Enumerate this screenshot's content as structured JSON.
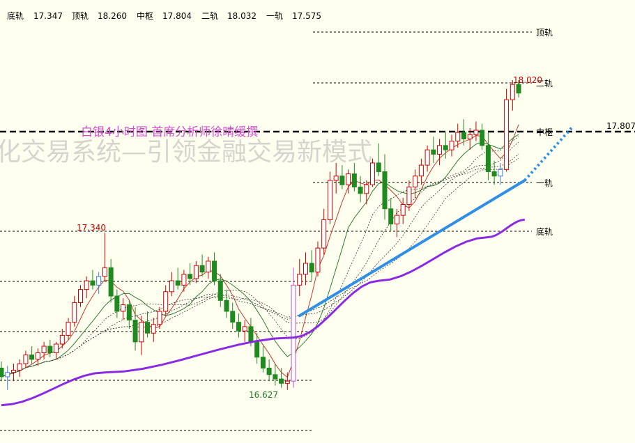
{
  "header": {
    "items": [
      {
        "label": "底轨",
        "value": "17.347"
      },
      {
        "label": "顶轨",
        "value": "18.260"
      },
      {
        "label": "中枢",
        "value": "17.804"
      },
      {
        "label": "二轨",
        "value": "18.032"
      },
      {
        "label": "一轨",
        "value": "17.575"
      }
    ]
  },
  "subtitle": "白银4小时图  首席分析师徐晴缓撰",
  "watermark": "化交易系统—引领金融交易新模式",
  "colors": {
    "background": "#fffff0",
    "up": "#cc0000",
    "down": "#1f8a1f",
    "special": "#3a7fdc",
    "trendline": "#2f8ee6",
    "slow_ma": "#8a2be2",
    "subtitle": "#d24fd0"
  },
  "chart_data": {
    "type": "candlestick",
    "y_range": [
      16.45,
      18.48
    ],
    "levels": [
      {
        "name": "顶轨",
        "value": 18.26
      },
      {
        "name": "二轨",
        "value": 18.032
      },
      {
        "name": "中枢",
        "value": 17.807
      },
      {
        "name": "一轨",
        "value": 17.575
      },
      {
        "name": "底轨",
        "value": 17.347
      }
    ],
    "annotations": [
      {
        "text": "18.020",
        "value": 18.02
      },
      {
        "text": "17.807",
        "value": 17.807
      },
      {
        "text": "17.340",
        "value": 17.34
      },
      {
        "text": "16.627",
        "value": 16.627
      }
    ],
    "candles": [
      [
        16.72,
        16.75,
        16.66,
        16.68
      ],
      [
        16.68,
        16.73,
        16.62,
        16.7
      ],
      [
        16.7,
        16.74,
        16.66,
        16.71
      ],
      [
        16.71,
        16.76,
        16.68,
        16.74
      ],
      [
        16.74,
        16.8,
        16.72,
        16.78
      ],
      [
        16.78,
        16.82,
        16.74,
        16.76
      ],
      [
        16.76,
        16.81,
        16.73,
        16.79
      ],
      [
        16.79,
        16.84,
        16.76,
        16.82
      ],
      [
        16.82,
        16.85,
        16.77,
        16.79
      ],
      [
        16.79,
        16.84,
        16.76,
        16.83
      ],
      [
        16.83,
        16.9,
        16.81,
        16.87
      ],
      [
        16.87,
        16.95,
        16.85,
        16.93
      ],
      [
        16.93,
        17.05,
        16.91,
        17.02
      ],
      [
        17.02,
        17.1,
        17.0,
        17.08
      ],
      [
        17.08,
        17.14,
        17.04,
        17.12
      ],
      [
        17.12,
        17.17,
        17.08,
        17.1
      ],
      [
        17.1,
        17.16,
        17.06,
        17.14
      ],
      [
        17.14,
        17.34,
        17.12,
        17.18
      ],
      [
        17.18,
        17.22,
        17.02,
        17.05
      ],
      [
        17.05,
        17.08,
        16.95,
        16.98
      ],
      [
        16.98,
        17.04,
        16.94,
        17.01
      ],
      [
        17.01,
        17.03,
        16.9,
        16.94
      ],
      [
        16.94,
        17.0,
        16.8,
        16.84
      ],
      [
        16.84,
        16.96,
        16.78,
        16.93
      ],
      [
        16.93,
        16.98,
        16.86,
        16.88
      ],
      [
        16.88,
        16.95,
        16.84,
        16.92
      ],
      [
        16.92,
        17.0,
        16.9,
        16.98
      ],
      [
        16.98,
        17.1,
        16.96,
        17.07
      ],
      [
        17.07,
        17.16,
        17.05,
        17.12
      ],
      [
        17.12,
        17.18,
        17.08,
        17.1
      ],
      [
        17.1,
        17.17,
        17.07,
        17.15
      ],
      [
        17.15,
        17.2,
        17.1,
        17.13
      ],
      [
        17.13,
        17.21,
        17.11,
        17.19
      ],
      [
        17.19,
        17.24,
        17.14,
        17.16
      ],
      [
        17.16,
        17.23,
        17.13,
        17.21
      ],
      [
        17.21,
        17.25,
        17.1,
        17.12
      ],
      [
        17.12,
        17.15,
        17.0,
        17.03
      ],
      [
        17.03,
        17.08,
        16.95,
        16.98
      ],
      [
        16.98,
        17.02,
        16.9,
        16.93
      ],
      [
        16.93,
        16.97,
        16.86,
        16.89
      ],
      [
        16.89,
        16.94,
        16.84,
        16.91
      ],
      [
        16.91,
        16.95,
        16.82,
        16.84
      ],
      [
        16.84,
        16.88,
        16.74,
        16.77
      ],
      [
        16.77,
        16.82,
        16.7,
        16.72
      ],
      [
        16.72,
        16.76,
        16.66,
        16.69
      ],
      [
        16.69,
        16.74,
        16.64,
        16.67
      ],
      [
        16.67,
        16.72,
        16.63,
        16.65
      ],
      [
        16.65,
        16.7,
        16.62,
        16.66
      ],
      [
        16.66,
        17.18,
        16.63,
        17.1
      ],
      [
        17.1,
        17.22,
        17.05,
        17.15
      ],
      [
        17.15,
        17.25,
        17.1,
        17.2
      ],
      [
        17.2,
        17.26,
        17.12,
        17.16
      ],
      [
        17.16,
        17.3,
        17.14,
        17.27
      ],
      [
        17.27,
        17.45,
        17.24,
        17.4
      ],
      [
        17.4,
        17.62,
        17.38,
        17.58
      ],
      [
        17.58,
        17.66,
        17.52,
        17.6
      ],
      [
        17.6,
        17.65,
        17.54,
        17.56
      ],
      [
        17.56,
        17.63,
        17.52,
        17.61
      ],
      [
        17.61,
        17.66,
        17.53,
        17.55
      ],
      [
        17.55,
        17.6,
        17.48,
        17.52
      ],
      [
        17.52,
        17.58,
        17.47,
        17.56
      ],
      [
        17.56,
        17.68,
        17.55,
        17.66
      ],
      [
        17.66,
        17.75,
        17.6,
        17.62
      ],
      [
        17.62,
        17.7,
        17.4,
        17.45
      ],
      [
        17.45,
        17.5,
        17.35,
        17.38
      ],
      [
        17.38,
        17.45,
        17.32,
        17.42
      ],
      [
        17.42,
        17.5,
        17.38,
        17.47
      ],
      [
        17.47,
        17.58,
        17.44,
        17.55
      ],
      [
        17.55,
        17.63,
        17.5,
        17.6
      ],
      [
        17.6,
        17.68,
        17.56,
        17.65
      ],
      [
        17.65,
        17.74,
        17.62,
        17.72
      ],
      [
        17.72,
        17.78,
        17.66,
        17.7
      ],
      [
        17.7,
        17.77,
        17.65,
        17.74
      ],
      [
        17.74,
        17.8,
        17.68,
        17.72
      ],
      [
        17.72,
        17.79,
        17.69,
        17.76
      ],
      [
        17.76,
        17.84,
        17.73,
        17.8
      ],
      [
        17.8,
        17.86,
        17.74,
        17.77
      ],
      [
        17.77,
        17.82,
        17.72,
        17.79
      ],
      [
        17.79,
        17.85,
        17.76,
        17.81
      ],
      [
        17.81,
        17.84,
        17.72,
        17.74
      ],
      [
        17.74,
        17.8,
        17.58,
        17.62
      ],
      [
        17.62,
        17.67,
        17.56,
        17.6
      ],
      [
        17.6,
        17.66,
        17.56,
        17.63
      ],
      [
        17.63,
        18.0,
        17.62,
        17.95
      ],
      [
        17.95,
        18.04,
        17.9,
        18.02
      ],
      [
        18.02,
        18.04,
        17.96,
        17.98
      ]
    ],
    "moving_average_slow": [
      [
        0,
        16.55
      ],
      [
        17,
        16.7
      ],
      [
        48,
        16.86
      ],
      [
        62,
        17.12
      ],
      [
        80,
        17.32
      ],
      [
        86,
        17.4
      ]
    ],
    "trendline": [
      [
        49,
        16.96
      ],
      [
        86,
        17.58
      ],
      [
        94,
        17.83
      ]
    ]
  }
}
